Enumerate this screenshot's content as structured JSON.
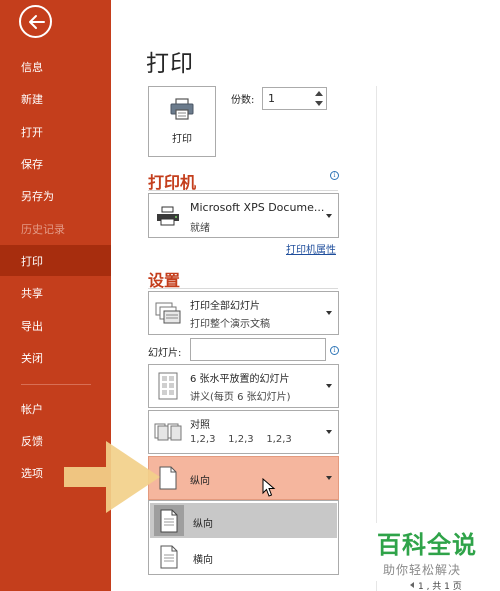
{
  "sidebar": {
    "items": [
      {
        "label": "信息"
      },
      {
        "label": "新建"
      },
      {
        "label": "打开"
      },
      {
        "label": "保存"
      },
      {
        "label": "另存为"
      },
      {
        "label": "历史记录"
      },
      {
        "label": "打印"
      },
      {
        "label": "共享"
      },
      {
        "label": "导出"
      },
      {
        "label": "关闭"
      },
      {
        "label": "帐户"
      },
      {
        "label": "反馈"
      },
      {
        "label": "选项"
      }
    ],
    "active": "打印",
    "disabled": "历史记录"
  },
  "main": {
    "title": "打印",
    "print_button_label": "打印",
    "copies_label": "份数:",
    "copies_value": "1",
    "printer_heading": "打印机",
    "printer_name": "Microsoft XPS Docume...",
    "printer_status": "就绪",
    "printer_properties_link": "打印机属性",
    "settings_heading": "设置",
    "setting_slides_range": {
      "title": "打印全部幻灯片",
      "subtitle": "打印整个演示文稿"
    },
    "slides_label": "幻灯片:",
    "slides_input_value": "",
    "setting_layout": {
      "title": "6 张水平放置的幻灯片",
      "subtitle": "讲义(每页 6 张幻灯片)"
    },
    "setting_collation": {
      "title": "对照",
      "subtitle": "1,2,3    1,2,3    1,2,3"
    },
    "setting_orientation": {
      "title": "纵向"
    },
    "orientation_menu": [
      {
        "label": "纵向",
        "selected": true
      },
      {
        "label": "横向",
        "selected": false
      }
    ],
    "info_icon_glyph": "i"
  },
  "preview": {
    "page_nav": "1  , 共 1 页"
  },
  "watermark": {
    "title": "百科全说",
    "subtitle": "助你轻松解决"
  },
  "colors": {
    "sidebar": "#C43E1C",
    "sidebar_active": "#A72D0E",
    "heading": "#C43E1C",
    "orientation_highlight": "#F5B69E",
    "arrow": "#F2D08A",
    "watermark_green": "#2FA349",
    "link": "#1F4E9C"
  },
  "icons": {
    "back": "back-arrow-icon",
    "printer": "printer-icon",
    "slides": "slides-icon",
    "layout": "handout-layout-icon",
    "collate": "collate-icon",
    "portrait": "portrait-page-icon",
    "landscape": "landscape-page-icon"
  }
}
